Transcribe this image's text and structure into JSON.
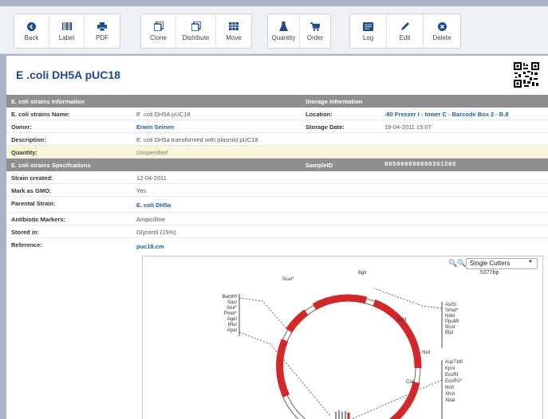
{
  "toolbar": {
    "buttons": [
      {
        "id": "back",
        "label": "Back",
        "icon": "back-icon"
      },
      {
        "id": "label",
        "label": "Label",
        "icon": "barcode-icon"
      },
      {
        "id": "pdf",
        "label": "PDF",
        "icon": "print-icon"
      },
      {
        "id": "clone",
        "label": "Clone",
        "icon": "clone-icon"
      },
      {
        "id": "distribute",
        "label": "Distribute",
        "icon": "distribute-icon"
      },
      {
        "id": "move",
        "label": "Move",
        "icon": "grid-icon"
      },
      {
        "id": "quantity",
        "label": "Quantity",
        "icon": "flask-icon"
      },
      {
        "id": "order",
        "label": "Order",
        "icon": "cart-icon"
      },
      {
        "id": "log",
        "label": "Log",
        "icon": "log-icon"
      },
      {
        "id": "edit",
        "label": "Edit",
        "icon": "pencil-icon"
      },
      {
        "id": "delete",
        "label": "Delete",
        "icon": "delete-icon"
      }
    ]
  },
  "page": {
    "title": "E .coli DH5A pUC18"
  },
  "details": {
    "section1_left": "E. coli strains Information",
    "section1_right": "Storage Information",
    "name_label": "E. coli strains Name:",
    "name_value": "E .coli DH5A pUC18",
    "location_label": "Location:",
    "location_value": "-80 Freezer I - tower C - Barcode Box 2 - B.8",
    "owner_label": "Owner:",
    "owner_value": "Erwin Seinen",
    "storage_date_label": "Storage Date:",
    "storage_date_value": "19-04-2011 15:07",
    "description_label": "Description:",
    "description_value": "E. coli DH5a transformed with plasmid pUC18",
    "quantity_label": "Quantity:",
    "quantity_value": "Unspecified",
    "section2_left": "E. coli strains Specifcations",
    "sampleid_label": "SampleID",
    "sampleid_value": "005000000000351260",
    "strain_created_label": "Strain created:",
    "strain_created_value": "12-04-2011",
    "gmo_label": "Mark as GMO:",
    "gmo_value": "Yes",
    "parental_label": "Parental Strain:",
    "parental_value": "E. coli DH5a",
    "antibiotic_label": "Antibiotic Markers:",
    "antibiotic_value": "Ampicilline",
    "stored_label": "Stored in:",
    "stored_value": "Glycerol (15%)",
    "reference_label": "Reference:",
    "reference_value": "puc18.cm"
  },
  "map": {
    "cutter_selected": "Single Cutters",
    "size_label": "5377bp",
    "enzymes_right_top": [
      "AsiSI",
      "SmaI*",
      "NdeI",
      "PpuMI",
      "NcoI",
      "BlpI"
    ],
    "enzymes_right_bottom": [
      "Asp718I",
      "KpnI",
      "EcoRI",
      "EcoRV*",
      "NotI",
      "XhoI",
      "XbaI"
    ],
    "enzymes_left": [
      "BamHI",
      "SacI",
      "StuI*",
      "PmeI*",
      "AgeI",
      "MluI",
      "ApaI"
    ],
    "enzymes_ring": [
      "ScaI*",
      "BglI",
      "SphI",
      "NsiI",
      "ClaI"
    ]
  }
}
